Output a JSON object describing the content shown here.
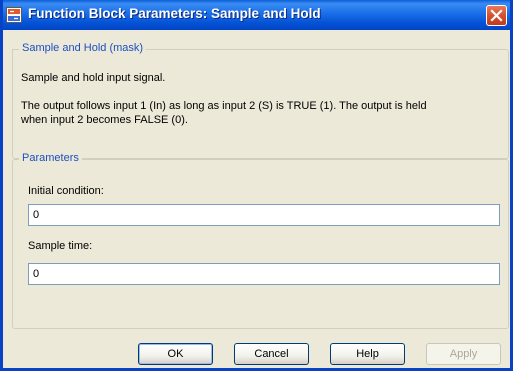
{
  "window": {
    "title": "Function Block Parameters: Sample and Hold",
    "icon": "simulink-block-icon",
    "close_icon": "close-icon"
  },
  "mask": {
    "group_title": "Sample and Hold  (mask)",
    "description": "Sample and hold input signal.",
    "details_line1": "The output follows input 1 (In) as long as input 2 (S) is TRUE (1). The output is held",
    "details_line2": "when input 2 becomes FALSE (0)."
  },
  "parameters": {
    "group_title": "Parameters",
    "initial_condition_label": "Initial condition:",
    "initial_condition_value": "0",
    "sample_time_label": "Sample time:",
    "sample_time_value": "0"
  },
  "buttons": {
    "ok": "OK",
    "cancel": "Cancel",
    "help": "Help",
    "apply": "Apply"
  },
  "colors": {
    "titlebar": "#0553d6",
    "dialog_bg": "#ece9d8",
    "group_title": "#1c4fc0",
    "close_button": "#d8502e"
  }
}
